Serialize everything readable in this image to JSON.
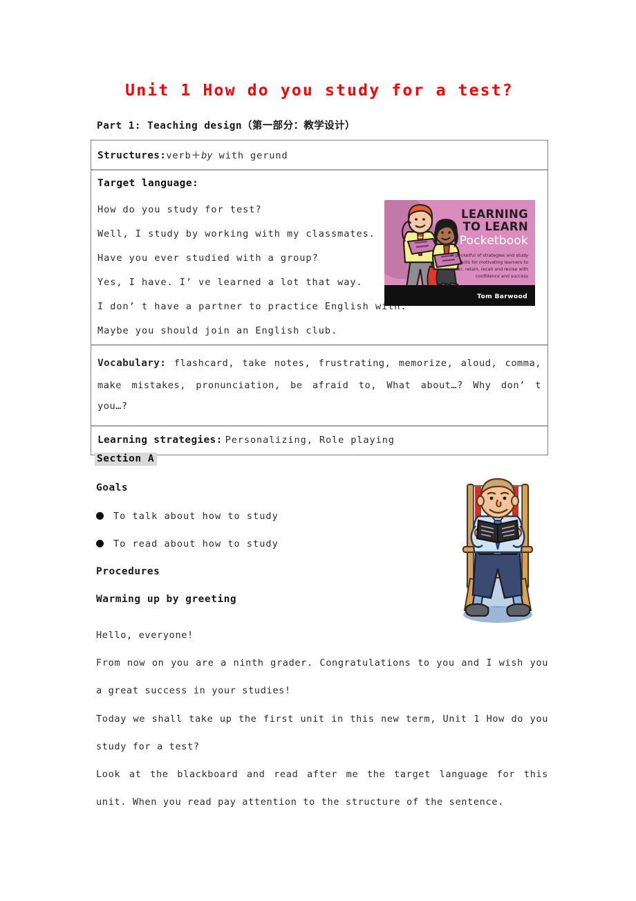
{
  "document": {
    "title": "Unit 1 How do you study for a test?",
    "part_line": "Part 1: Teaching design（第一部分：教学设计）"
  },
  "table": {
    "structures": {
      "label": "Structures:",
      "text_before": "verb＋",
      "italic": "by",
      "text_after": " with gerund"
    },
    "target_language": {
      "label": "Target language:",
      "lines": [
        "How do you study for test?",
        "Well, I study by working with my classmates.",
        "Have you ever studied with a group?",
        "Yes, I have. I’ ve learned a lot that way.",
        "I don’ t have a partner to practice English with.",
        "Maybe you should join an English club."
      ]
    },
    "vocabulary": {
      "label": "Vocabulary:",
      "text": "flashcard, take notes, frustrating, memorize, aloud, comma, make mistakes, pronunciation, be afraid to, What about…? Why don’ t you…?"
    },
    "learning_strategies": {
      "label": "Learning strategies:",
      "text": "Personalizing, Role playing"
    }
  },
  "book_cover": {
    "title_line1": "LEARNING",
    "title_line2": "TO LEARN",
    "subtitle": "Pocketbook",
    "blurb": "A pocketful of strategies and study skills for motivating learners to register, retain, recall and revise with confidence and success",
    "author": "Tom Barwood",
    "colors": {
      "background": "#d98cbd",
      "band": "#101010",
      "title_text": "#231f20",
      "subtitle_text": "#ffffff"
    }
  },
  "section": {
    "heading": "Section A",
    "heading_highlight": "#d9d9d9",
    "goals_heading": "Goals",
    "goals": [
      "To talk about how to study",
      "To read about how to study"
    ],
    "procedures_heading": "Procedures",
    "warming_heading": "Warming up by greeting",
    "paragraphs": {
      "hello": "Hello, everyone!",
      "from_now": "From now on you are a ninth grader. Congratulations to you and I wish you a great success in your studies!",
      "today": "Today we shall take up the first unit in this new term, Unit 1 How do you study for a test?",
      "look": "Look at the blackboard and read after me the target language for this unit. When you read pay attention to the structure of the sentence."
    }
  },
  "colors": {
    "title_red": "#ff0000",
    "page_background": "#ffffff",
    "table_border": "#808080",
    "body_text": "#2b2b2b"
  }
}
